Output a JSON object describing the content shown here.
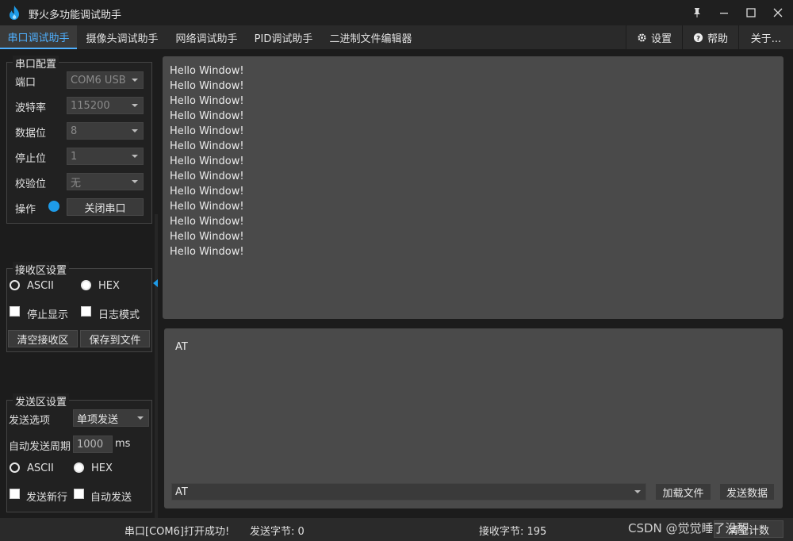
{
  "window": {
    "title": "野火多功能调试助手"
  },
  "menu": {
    "tabs": [
      "串口调试助手",
      "摄像头调试助手",
      "网络调试助手",
      "PID调试助手",
      "二进制文件编辑器"
    ],
    "settings": "设置",
    "help": "帮助",
    "about": "关于..."
  },
  "serial_config": {
    "title": "串口配置",
    "port_label": "端口",
    "port_value": "COM6 USB",
    "baud_label": "波特率",
    "baud_value": "115200",
    "databits_label": "数据位",
    "databits_value": "8",
    "stopbits_label": "停止位",
    "stopbits_value": "1",
    "parity_label": "校验位",
    "parity_value": "无",
    "op_label": "操作",
    "op_button": "关闭串口",
    "status_color": "#1e9be8"
  },
  "receive_settings": {
    "title": "接收区设置",
    "ascii": "ASCII",
    "hex": "HEX",
    "stop_display": "停止显示",
    "log_mode": "日志模式",
    "clear_button": "清空接收区",
    "save_button": "保存到文件"
  },
  "send_settings": {
    "title": "发送区设置",
    "option_label": "发送选项",
    "option_value": "单项发送",
    "period_label": "自动发送周期",
    "period_value": "1000",
    "period_unit": "ms",
    "ascii": "ASCII",
    "hex": "HEX",
    "newline": "发送新行",
    "auto_send": "自动发送"
  },
  "receive_area": {
    "lines": [
      "Hello Window!",
      "Hello Window!",
      "Hello Window!",
      "Hello Window!",
      "Hello Window!",
      "Hello Window!",
      "Hello Window!",
      "Hello Window!",
      "Hello Window!",
      "Hello Window!",
      "Hello Window!",
      "Hello Window!",
      "Hello Window!"
    ]
  },
  "send_area": {
    "text": "AT",
    "combo_value": "AT",
    "load_file": "加载文件",
    "send_data": "发送数据"
  },
  "statusbar": {
    "message": "串口[COM6]打开成功!",
    "sent_bytes": "发送字节: 0",
    "recv_bytes": "接收字节: 195",
    "clear_count": "清空计数",
    "watermark": "CSDN @觉觉睡了没醒"
  }
}
